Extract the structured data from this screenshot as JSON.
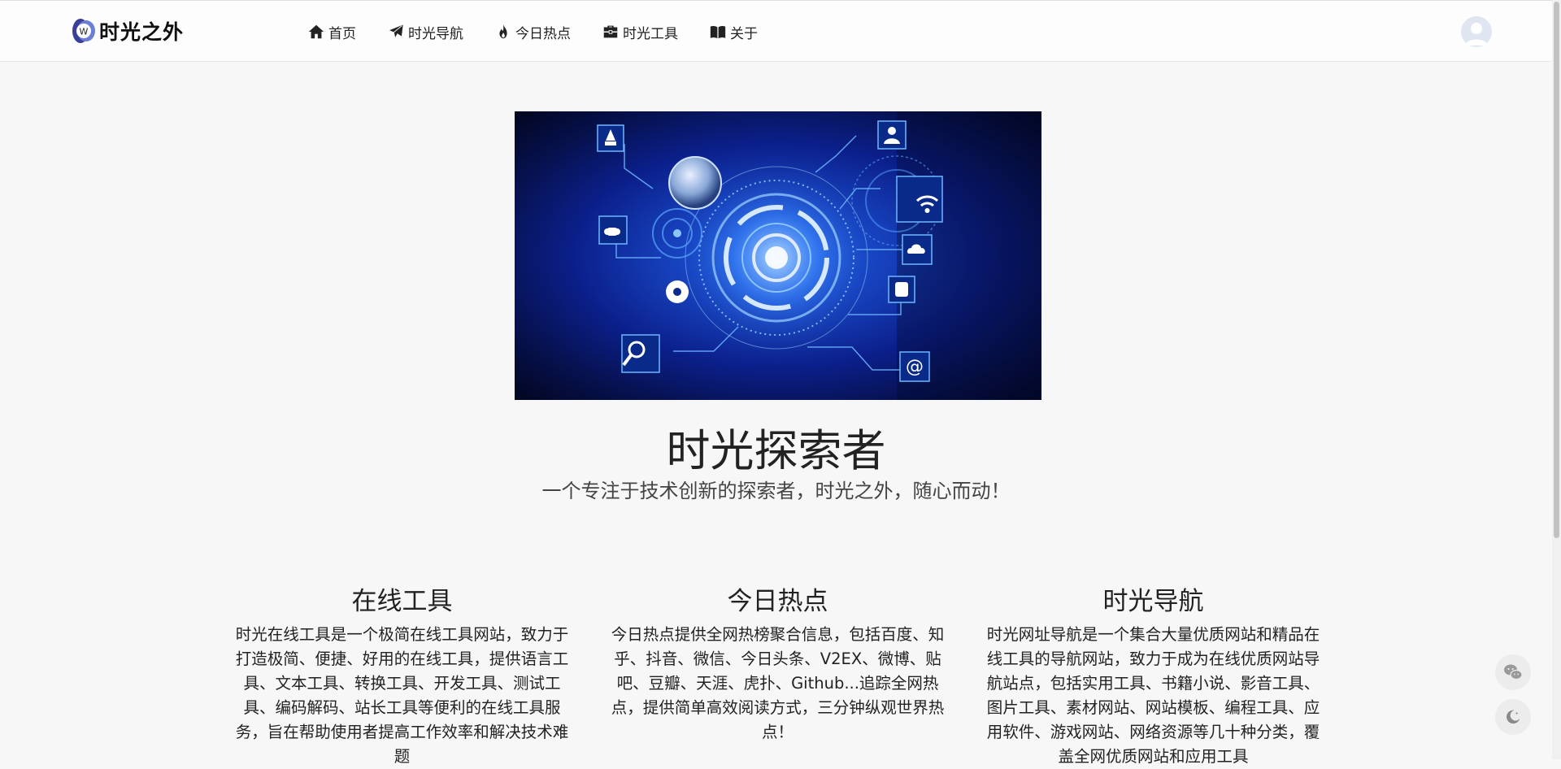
{
  "brand": {
    "name": "时光之外",
    "mark_letter": "W"
  },
  "nav": [
    {
      "label": "首页",
      "icon": "home-icon"
    },
    {
      "label": "时光导航",
      "icon": "paper-plane-icon"
    },
    {
      "label": "今日热点",
      "icon": "fire-icon"
    },
    {
      "label": "时光工具",
      "icon": "toolbox-icon"
    },
    {
      "label": "关于",
      "icon": "book-icon"
    }
  ],
  "hero": {
    "email_symbol": "@"
  },
  "main": {
    "title": "时光探索者",
    "subtitle": "一个专注于技术创新的探索者，时光之外，随心而动！"
  },
  "features": [
    {
      "title": "在线工具",
      "text": "时光在线工具是一个极简在线工具网站，致力于打造极简、便捷、好用的在线工具，提供语言工具、文本工具、转换工具、开发工具、测试工具、编码解码、站长工具等便利的在线工具服务，旨在帮助使用者提高工作效率和解决技术难题"
    },
    {
      "title": "今日热点",
      "text": "今日热点提供全网热榜聚合信息，包括百度、知乎、抖音、微信、今日头条、V2EX、微博、贴吧、豆瓣、天涯、虎扑、Github...追踪全网热点，提供简单高效阅读方式，三分钟纵观世界热点！"
    },
    {
      "title": "时光导航",
      "text": "时光网址导航是一个集合大量优质网站和精品在线工具的导航网站，致力于成为在线优质网站导航站点，包括实用工具、书籍小说、影音工具、图片工具、素材网站、网站模板、编程工具、应用软件、游戏网站、网络资源等几十种分类，覆盖全网优质网站和应用工具"
    }
  ],
  "floating": [
    {
      "icon": "wechat-icon"
    },
    {
      "icon": "moon-icon"
    }
  ],
  "colors": {
    "accent": "#1846c4",
    "background": "#f7f7f7"
  }
}
